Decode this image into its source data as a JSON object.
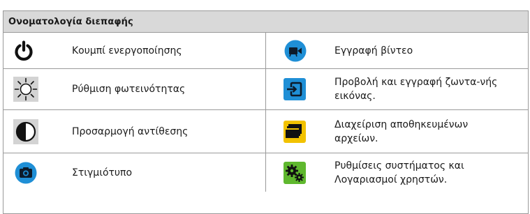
{
  "header": {
    "title": "Ονοματολογία διεπαφής"
  },
  "rows": [
    {
      "left": {
        "icon": "power-icon",
        "label": "Κουμπί ενεργοποίησης"
      },
      "right": {
        "icon": "video-camera-icon",
        "label": "Εγγραφή βίντεο"
      }
    },
    {
      "left": {
        "icon": "brightness-sun-icon",
        "label": "Ρύθμιση φωτεινότητας"
      },
      "right": {
        "icon": "input-enter-icon",
        "label": "Προβολή και εγγραφή ζωντα-νής εικόνας."
      }
    },
    {
      "left": {
        "icon": "contrast-icon",
        "label": "Προσαρμογή αντίθεσης"
      },
      "right": {
        "icon": "file-stack-icon",
        "label": "Διαχείριση αποθηκευμένων αρχείων."
      }
    },
    {
      "left": {
        "icon": "camera-icon",
        "label": "Στιγμιότυπο"
      },
      "right": {
        "icon": "gears-icon",
        "label": "Ρυθμίσεις συστήματος και Λογαριασμοί χρηστών."
      }
    }
  ],
  "colors": {
    "header_bg": "#d9d9d9",
    "blue_icon": "#1f8fd6",
    "yellow_icon": "#f2c200",
    "green_icon": "#5fb82e"
  }
}
